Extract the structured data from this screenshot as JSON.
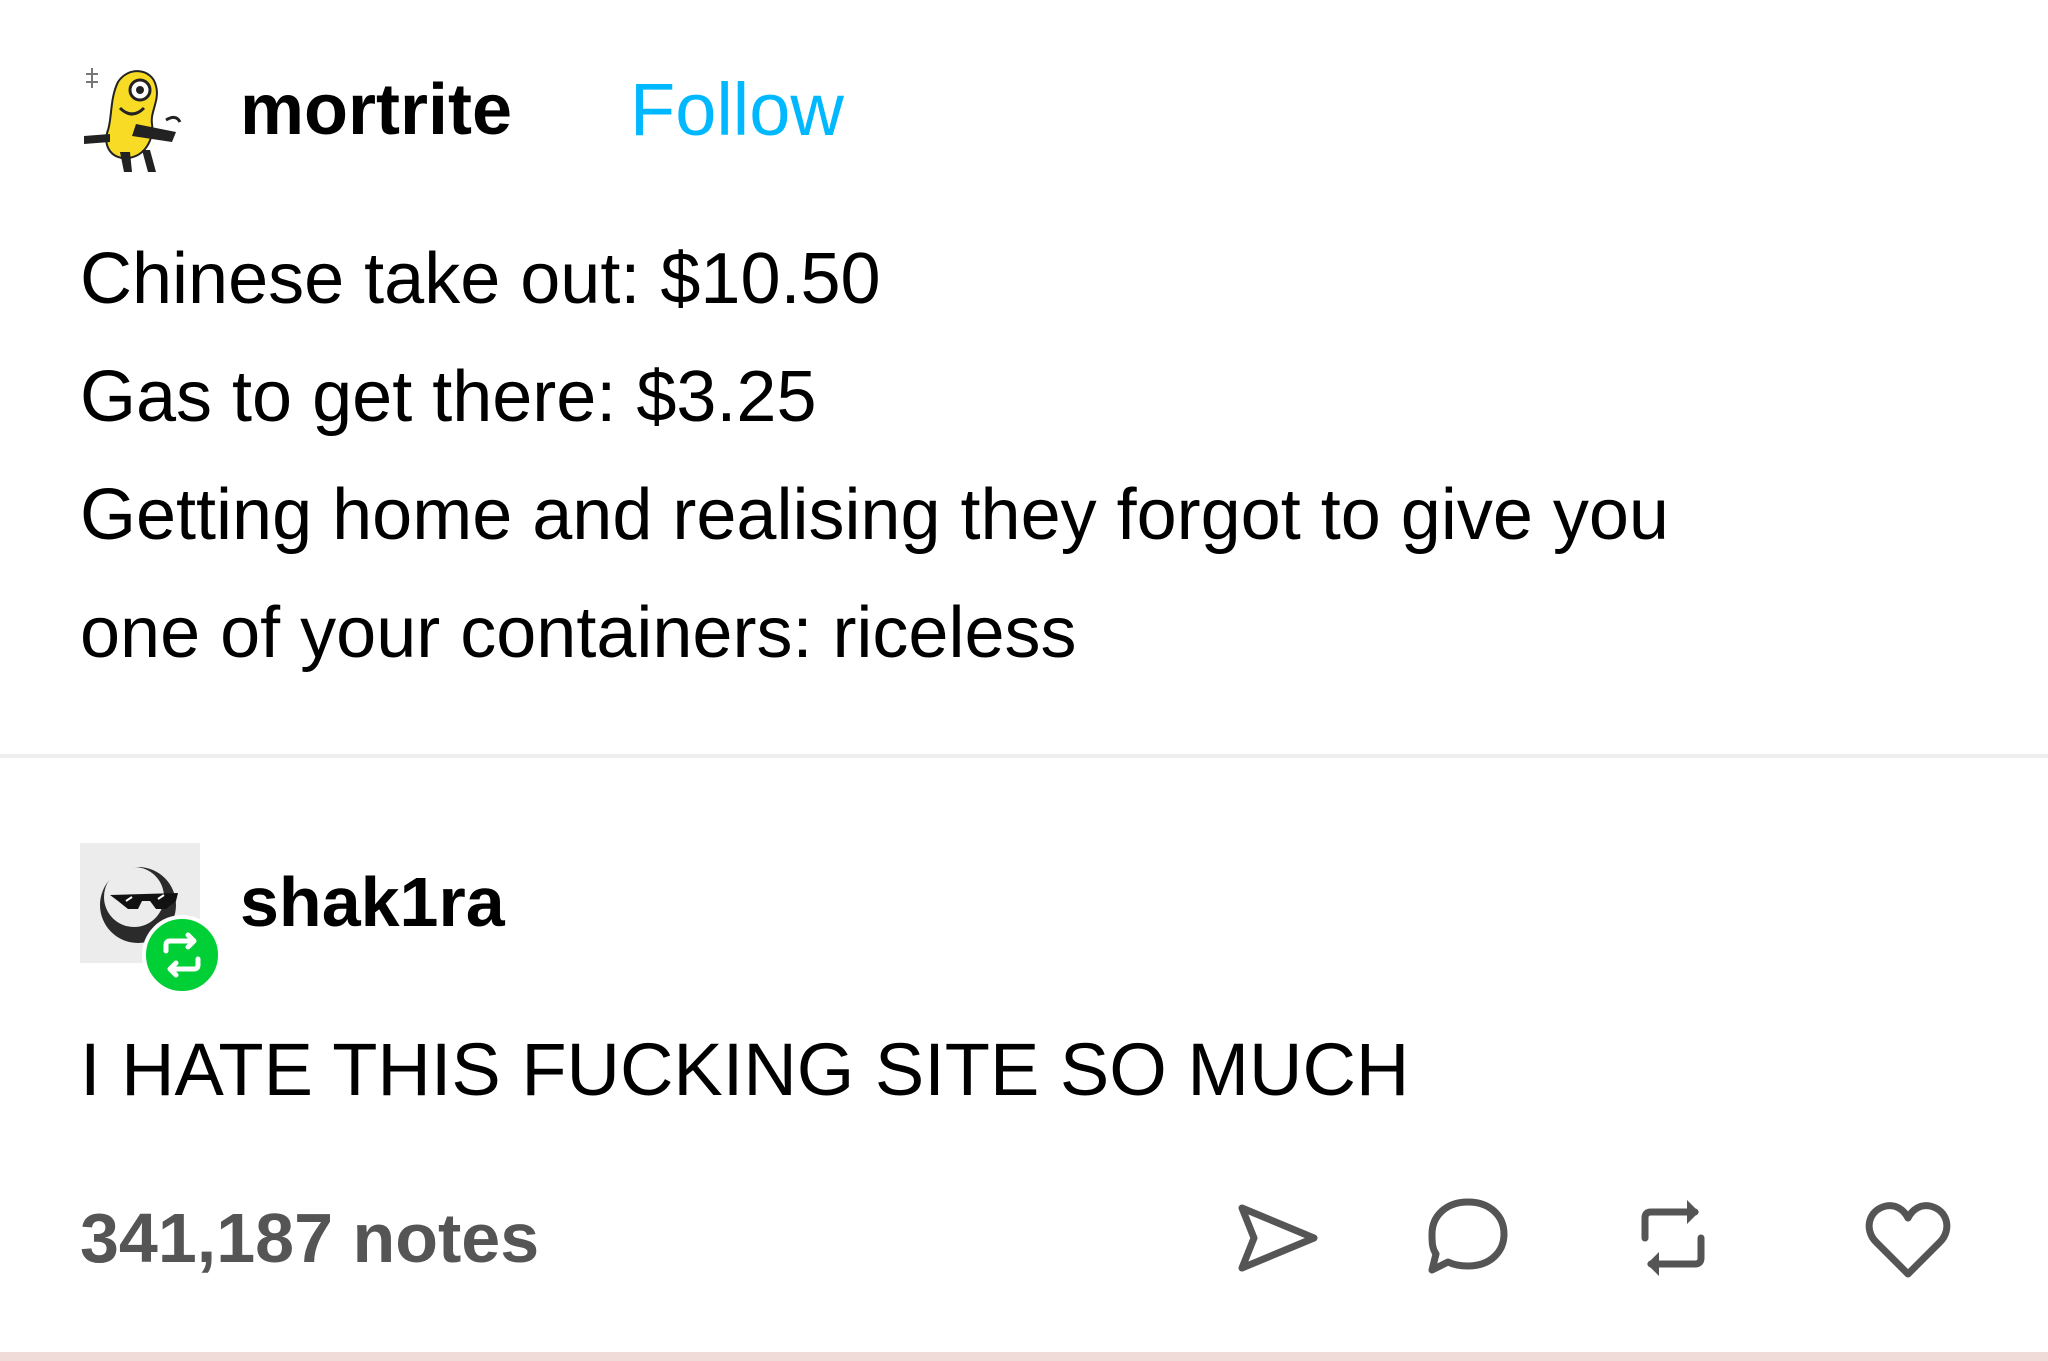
{
  "original_post": {
    "username": "mortrite",
    "follow_label": "Follow",
    "lines": [
      "Chinese take out: $10.50",
      "Gas to get there: $3.25",
      "Getting home and realising they forgot to give you",
      "one of your containers: riceless"
    ]
  },
  "reblog": {
    "username": "shak1ra",
    "text": "I HATE THIS FUCKING SITE SO MUCH"
  },
  "footer": {
    "notes": "341,187 notes",
    "icons": [
      "share-icon",
      "reply-icon",
      "reblog-icon",
      "like-icon"
    ]
  },
  "colors": {
    "follow": "#00b8ff",
    "reblog_badge": "#00cf35",
    "notes_text": "#555555",
    "divider": "#eeeeee",
    "bottom_strip": "#f1dbd8"
  }
}
